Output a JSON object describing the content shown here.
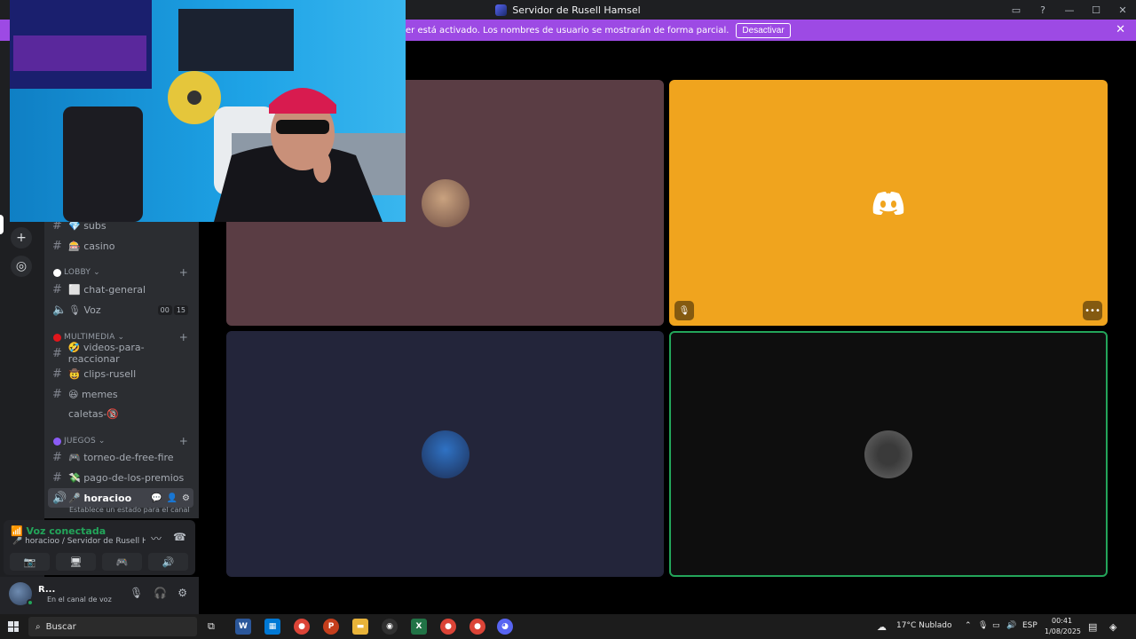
{
  "window": {
    "title": "Servidor de Rusell Hamsel",
    "controls": [
      "▭",
      "?",
      "—",
      "☐",
      "✕"
    ]
  },
  "banner": {
    "text": "modo Streamer está activado. Los nombres de usuario se mostrarán de forma parcial.",
    "button": "Desactivar"
  },
  "sidebar": {
    "channels_top": [
      {
        "label": "💎 subs"
      },
      {
        "label": "🎰 casino"
      }
    ],
    "lobby": {
      "title": "LOBBY",
      "color": "#ffffff",
      "channels": [
        {
          "label": "⬜ chat-general"
        }
      ],
      "voice": {
        "label": "🎙 Voz",
        "count": "00",
        "limit": "15"
      }
    },
    "multimedia": {
      "title": "MULTIMEDIA",
      "color": "#e1161c",
      "channels": [
        {
          "label": "🤣 videos-para-reaccionar"
        },
        {
          "label": "🤠 clips-rusell"
        },
        {
          "label": "😆 memes"
        },
        {
          "label": "caletas-🔞"
        }
      ]
    },
    "juegos": {
      "title": "JUEGOS",
      "color": "#8b5cf6",
      "channels": [
        {
          "label": "🎮 torneo-de-free-fire"
        },
        {
          "label": "💸 pago-de-los-premios"
        }
      ]
    },
    "active_voice": {
      "label": "🎤 horacioo",
      "hint": "Establece un estado para el canal"
    }
  },
  "voice_panel": {
    "status": "Voz conectada",
    "channel": "🎤 horacioo / Servidor de Rusell H..."
  },
  "user_panel": {
    "name": "R...",
    "status": "En el canal de voz",
    "avatar_color": "#4a6a94"
  },
  "grid": {
    "tiles": [
      {
        "color": "#5a3d44",
        "avatar": "#8a6a5a"
      },
      {
        "color": "#f0a41e",
        "avatar": "discord-logo"
      },
      {
        "color": "#23253a",
        "avatar": "#4f7fc0"
      },
      {
        "color": "#0e0e0e",
        "avatar": "#2a2a2a",
        "speaking": true
      }
    ]
  },
  "taskbar": {
    "search": "Buscar",
    "weather": "17°C  Nublado",
    "lang": "ESP",
    "time": "00:41",
    "date": "1/08/2025",
    "apps": [
      {
        "name": "word",
        "color": "#2b579a",
        "glyph": "W"
      },
      {
        "name": "store",
        "color": "#0078d4",
        "glyph": "▦"
      },
      {
        "name": "chrome",
        "color": "#db4437",
        "glyph": "●"
      },
      {
        "name": "powerpoint",
        "color": "#c43e1c",
        "glyph": "P"
      },
      {
        "name": "explorer",
        "color": "#e8b339",
        "glyph": "▬"
      },
      {
        "name": "obs",
        "color": "#303030",
        "glyph": "◉"
      },
      {
        "name": "excel",
        "color": "#217346",
        "glyph": "X"
      },
      {
        "name": "chrome-2",
        "color": "#db4437",
        "glyph": "●"
      },
      {
        "name": "chrome-3",
        "color": "#db4437",
        "glyph": "●"
      },
      {
        "name": "discord",
        "color": "#5865f2",
        "glyph": "◕"
      }
    ]
  }
}
